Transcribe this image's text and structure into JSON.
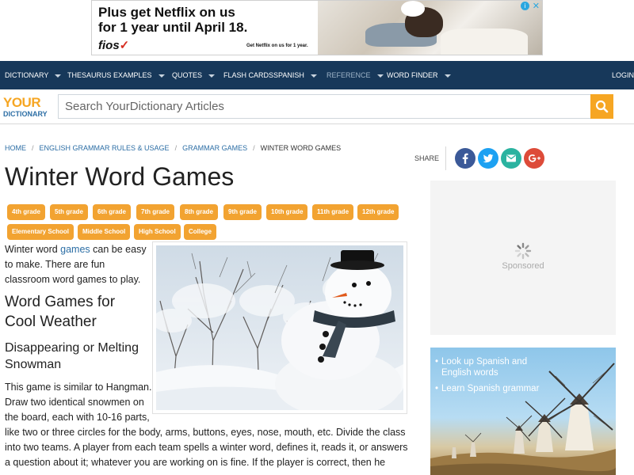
{
  "ad": {
    "headline_line1": "Plus get Netflix on us",
    "headline_line2": "for 1 year until April 18.",
    "brand": "fios",
    "brand_mark": "✓",
    "fine_print": "Get Netflix on us for 1 year.",
    "info_glyph": "i",
    "close_glyph": "✕"
  },
  "nav": {
    "items": [
      {
        "label": "DICTIONARY",
        "caret": true
      },
      {
        "label": "THESAURUS",
        "caret": false
      },
      {
        "label": "EXAMPLES",
        "caret": true
      },
      {
        "label": "QUOTES",
        "caret": true
      },
      {
        "label": "FLASH CARDS",
        "caret": false
      },
      {
        "label": "SPANISH",
        "caret": true
      },
      {
        "label": "REFERENCE",
        "caret": true
      },
      {
        "label": "WORD FINDER",
        "caret": true
      }
    ],
    "login": "LOGIN"
  },
  "logo": {
    "line1": "YOUR",
    "line2": "DICTIONARY"
  },
  "search": {
    "placeholder": "Search YourDictionary Articles"
  },
  "breadcrumb": {
    "items": [
      "HOME",
      "ENGLISH GRAMMAR RULES & USAGE",
      "GRAMMAR GAMES"
    ],
    "current": "WINTER WORD GAMES",
    "separator": "/"
  },
  "share": {
    "label": "SHARE",
    "buttons": [
      {
        "icon": "facebook-icon",
        "color": "#3b5998"
      },
      {
        "icon": "twitter-icon",
        "color": "#1da1f2"
      },
      {
        "icon": "email-icon",
        "color": "#2bb3a0"
      },
      {
        "icon": "google-plus-icon",
        "color": "#dd4b39"
      }
    ]
  },
  "page": {
    "title": "Winter Word Games"
  },
  "tags": {
    "row1": [
      "4th grade",
      "5th grade",
      "6th grade",
      "7th grade",
      "8th grade",
      "9th grade",
      "10th grade",
      "11th grade",
      "12th grade"
    ],
    "row2": [
      "Elementary School",
      "Middle School",
      "High School",
      "College"
    ]
  },
  "article": {
    "intro_line1_pre": "Winter word ",
    "intro_link": "games",
    "intro_line1_post": " can be easy",
    "intro_line2": "to make. There are fun",
    "intro_line3": "classroom word games to play.",
    "h2_line1": "Word Games for",
    "h2_line2": "Cool Weather",
    "h3_line1": "Disappearing or Melting",
    "h3_line2": "Snowman",
    "body_lines": [
      "This game is similar to Hangman.",
      "Draw two identical snowmen on",
      "the board, each with 10-16 parts,",
      "like two or three circles for the body, arms, buttons, eyes, nose, mouth, etc. Divide the class",
      "into two teams. A player from each team spells a winter word, defines it, reads it, or answers",
      "a question about it; whatever you are working on is fine. If the player is correct, then he"
    ]
  },
  "sidebar": {
    "sponsored": "Sponsored",
    "promo_items": [
      "Look up Spanish and",
      "English words",
      "Learn Spanish grammar"
    ]
  },
  "colors": {
    "nav_bg": "#17385a",
    "accent_orange": "#f2a331",
    "link_blue": "#2c6ea5"
  }
}
